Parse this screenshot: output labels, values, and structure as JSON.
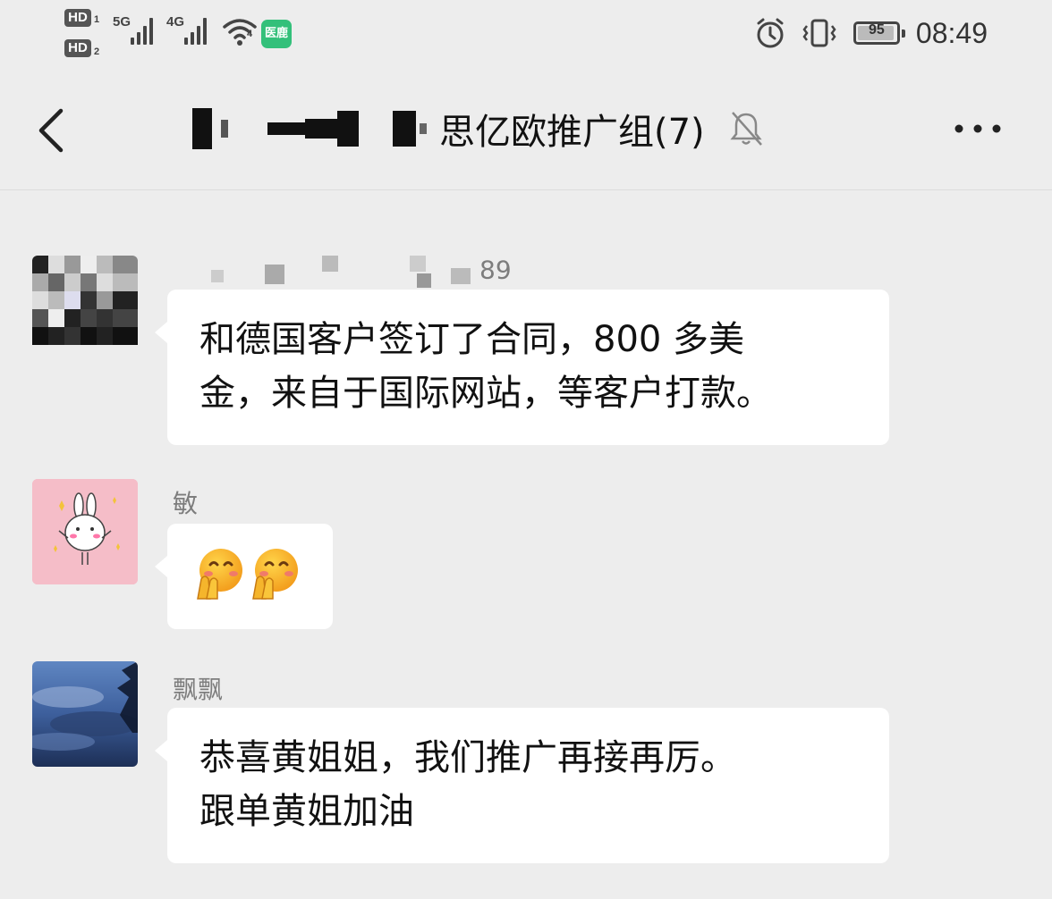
{
  "status_bar": {
    "sim1_label": "HD",
    "sim1_index": "1",
    "sim2_label": "HD",
    "sim2_index": "2",
    "net1": "5G",
    "net2": "4G",
    "wifi_label": "4",
    "app_badge": "医鹿",
    "battery_level": "95",
    "battery_fraction": 0.95,
    "time": "08:49",
    "icons": [
      "alarm-icon",
      "vibrate-icon",
      "battery-icon",
      "wifi-icon",
      "signal-icon"
    ]
  },
  "nav": {
    "back_icon": "chevron-left-icon",
    "title": "思亿欧推广组(7)",
    "mute_icon": "bell-muted-icon",
    "more_icon": "more-dots-icon"
  },
  "messages": [
    {
      "sender": "89",
      "lines": [
        "和德国客户签订了合同，800 多美",
        "金，来自于国际网站，等客户打款。"
      ]
    },
    {
      "sender": "敏",
      "emojis": [
        "🤭",
        "🤭"
      ]
    },
    {
      "sender": "飘飘",
      "lines": [
        "恭喜黄姐姐，我们推广再接再厉。",
        "跟单黄姐加油"
      ]
    }
  ],
  "colors": {
    "background": "#ededed",
    "bubble": "#ffffff",
    "sender_text": "#7d7d7d",
    "primary_text": "#111111"
  }
}
